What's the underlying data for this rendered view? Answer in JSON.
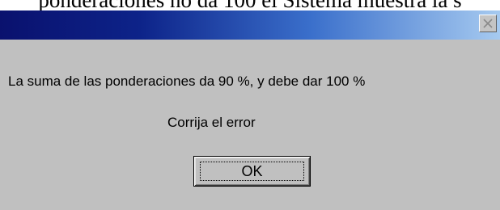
{
  "document": {
    "cut_off_heading": "ponderaciones no da 100 el Sistema muestra la s"
  },
  "dialog": {
    "title": "",
    "message_line_1": "La suma de las ponderaciones da 90 %, y debe dar 100 %",
    "message_line_2": "Corrija el error",
    "ok_label": "OK",
    "close_icon": "close-x-icon",
    "colors": {
      "face": "#c0c0c0",
      "title_gradient_start": "#0a116e",
      "title_gradient_end": "#a6caf0"
    }
  }
}
